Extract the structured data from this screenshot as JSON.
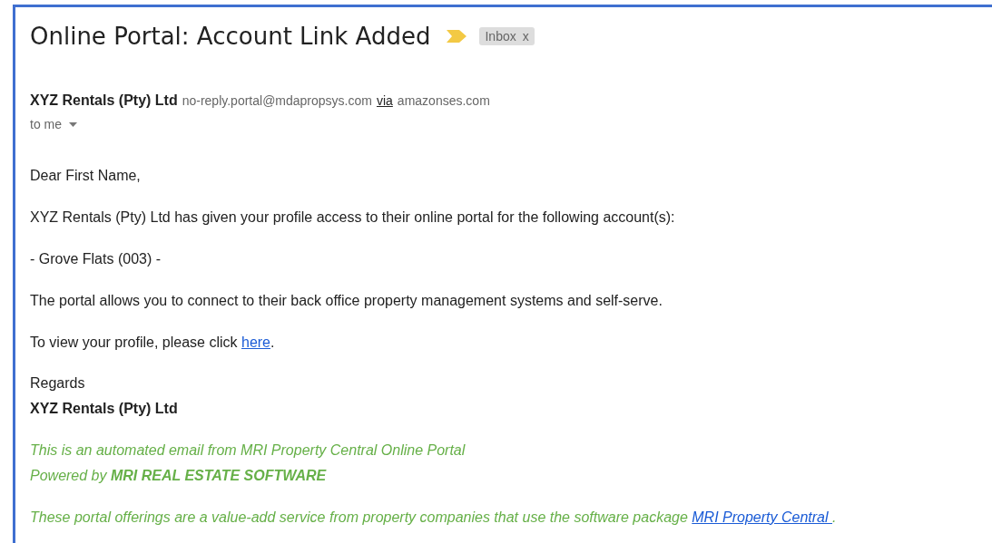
{
  "subject": "Online Portal: Account Link Added",
  "label": {
    "text": "Inbox",
    "close": "x"
  },
  "sender": {
    "name": "XYZ Rentals (Pty) Ltd",
    "email": "no-reply.portal@mdapropsys.com",
    "via": "via",
    "domain": "amazonses.com"
  },
  "recipient": "to me",
  "body": [
    {
      "text": "Dear First Name,"
    },
    {
      "text": "XYZ Rentals (Pty) Ltd has given your profile access to their online portal for the following account(s):"
    },
    {
      "text": "- Grove Flats (003) -"
    },
    {
      "text": "The portal allows you to connect to their back office property management systems and self-serve."
    },
    {
      "text": "To view your profile, please click ",
      "link": "here",
      "after": "."
    }
  ],
  "closing": "Regards",
  "signature": "XYZ Rentals (Pty) Ltd",
  "footer": {
    "line1": "This is an automated email from MRI Property Central Online Portal",
    "line2": "Powered by **MRI REAL ESTATE SOFTWARE**",
    "line3": "These portal offerings are a value-add service from property companies that use the software package ",
    "link": "MRI Property Central ",
    "after": "."
  }
}
